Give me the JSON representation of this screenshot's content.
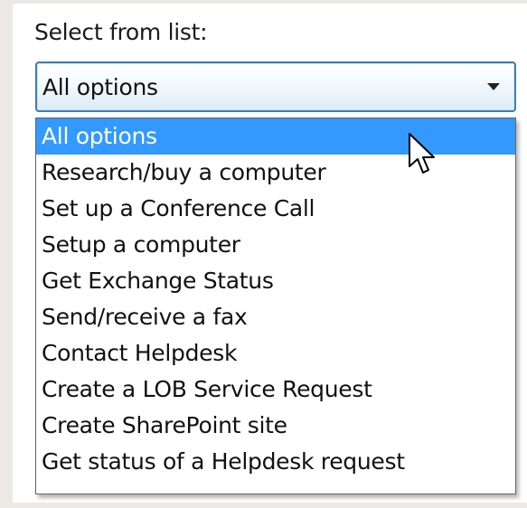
{
  "select_label": "Select from list:",
  "combo": {
    "value": "All options"
  },
  "options": [
    "All options",
    "Research/buy a computer",
    "Set up a Conference Call",
    "Setup a computer",
    "Get Exchange Status",
    "Send/receive a fax",
    "Contact Helpdesk",
    "Create a LOB Service Request",
    "Create SharePoint site",
    "Get status of a Helpdesk request"
  ],
  "selected_index": 0,
  "colors": {
    "highlight": "#3399ff",
    "combo_border": "#3c7fb1"
  },
  "icons": {
    "combo_arrow": "chevron-down-icon",
    "pointer": "mouse-cursor-icon"
  }
}
